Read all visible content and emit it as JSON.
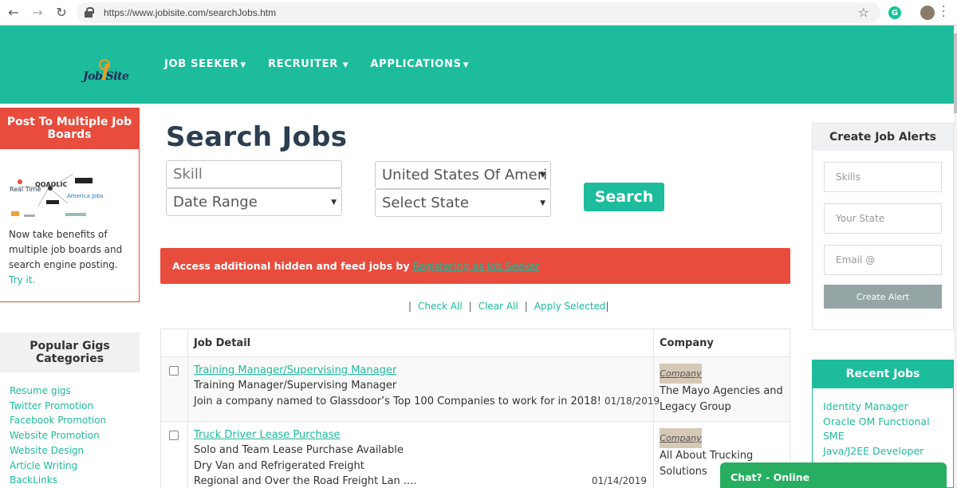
{
  "browser": {
    "url": "https://www.jobisite.com/searchJobs.htm",
    "extension_icon": "G"
  },
  "header": {
    "logo_text": "Job Site",
    "nav": [
      {
        "label": "JOB SEEKER"
      },
      {
        "label": "RECRUITER"
      },
      {
        "label": "APPLICATIONS"
      }
    ]
  },
  "promo": {
    "title": "Post To Multiple Job Boards",
    "diagram_labels": [
      "Real Time",
      "QOAOLIC",
      "America Jobs"
    ],
    "text": "Now take benefits of multiple job boards and search engine posting.",
    "link": "Try it."
  },
  "gigs": {
    "title": "Popular Gigs Categories",
    "items": [
      "Resume gigs",
      "Twitter Promotion",
      "Facebook Promotion",
      "Website Promotion",
      "Website Design",
      "Article Writing",
      "BackLinks"
    ]
  },
  "search": {
    "title": "Search Jobs",
    "skill_placeholder": "Skill",
    "date_range": "Date Range",
    "country": "United States Of Ameri",
    "state": "Select State",
    "button": "Search"
  },
  "alert_bar": {
    "text": "Access additional hidden and feed jobs by",
    "link": "Registering as Job Seeker"
  },
  "actions": {
    "check_all": "Check All",
    "clear_all": "Clear All",
    "apply_selected": "Apply Selected"
  },
  "table": {
    "headers": [
      "Job Detail",
      "Company"
    ],
    "rows": [
      {
        "title": "Training Manager/Supervising Manager",
        "lines": [
          "Training Manager/Supervising Manager",
          "Join a company named to Glassdoor’s Top 100 Companies to work for in 2018!"
        ],
        "date": "01/18/2019",
        "company_logo": "Company",
        "company": "The Mayo Agencies and Legacy Group"
      },
      {
        "title": "Truck Driver Lease Purchase",
        "lines": [
          "Solo and Team Lease Purchase Available",
          "Dry Van and Refrigerated Freight",
          "Regional and Over the Road Freight Lan ...."
        ],
        "date": "01/14/2019",
        "company_logo": "Company",
        "company": "All About Trucking Solutions"
      }
    ]
  },
  "job_alerts": {
    "title": "Create Job Alerts",
    "skills_placeholder": "Skills",
    "state_placeholder": "Your State",
    "email_placeholder": "Email @",
    "button": "Create Alert"
  },
  "recent_jobs": {
    "title": "Recent Jobs",
    "items": [
      "Identity Manager",
      "Oracle OM Functional SME",
      "Java/J2EE Developer"
    ]
  },
  "chat": {
    "label": "Chat? - Online"
  },
  "colors": {
    "brand": "#1dbc9c",
    "accent_red": "#e84c3d",
    "title_dark": "#2c3e50",
    "chat_green": "#27ae60"
  }
}
